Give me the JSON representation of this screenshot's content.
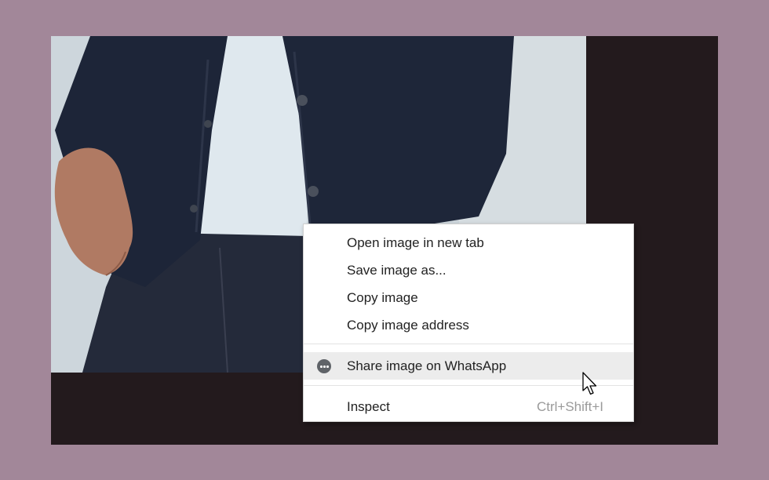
{
  "context_menu": {
    "items": [
      {
        "label": "Open image in new tab"
      },
      {
        "label": "Save image as..."
      },
      {
        "label": "Copy image"
      },
      {
        "label": "Copy image address"
      }
    ],
    "share": {
      "label": "Share image on WhatsApp",
      "icon": "whatsapp-icon"
    },
    "inspect": {
      "label": "Inspect",
      "shortcut": "Ctrl+Shift+I"
    }
  },
  "colors": {
    "page_background": "#a28799",
    "frame_background": "#231a1d",
    "menu_background": "#ffffff",
    "hover_background": "#ececec",
    "shortcut_text": "#9a9a9a"
  }
}
